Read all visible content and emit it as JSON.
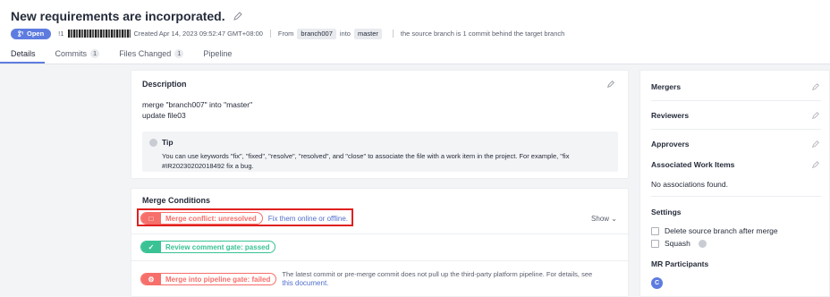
{
  "mr": {
    "title": "New requirements are incorporated.",
    "status": "Open",
    "id": "!1",
    "created": "Created Apr 14, 2023 09:52:47 GMT+08:00",
    "from_label": "From",
    "source_branch": "branch007",
    "into_label": "into",
    "target_branch": "master",
    "behind_note": "the source branch is 1 commit behind the target branch"
  },
  "tabs": [
    {
      "label": "Details",
      "count": ""
    },
    {
      "label": "Commits",
      "count": "1"
    },
    {
      "label": "Files Changed",
      "count": "1"
    },
    {
      "label": "Pipeline",
      "count": ""
    }
  ],
  "description": {
    "title": "Description",
    "line1": "merge \"branch007\" into \"master\"",
    "line2": "update file03",
    "tip_title": "Tip",
    "tip_text": "You can use keywords \"fix\", \"fixed\", \"resolve\", \"resolved\", and \"close\" to associate the file with a work item in the project. For example, \"fix #IR20230202018492 fix a bug."
  },
  "merge_conditions": {
    "title": "Merge Conditions",
    "show_label": "Show",
    "conflict": {
      "label": "Merge conflict: unresolved",
      "link": "Fix them online or offline.",
      "status": "failed"
    },
    "review": {
      "label": "Review comment gate: passed",
      "status": "passed"
    },
    "pipeline": {
      "label": "Merge into pipeline gate: failed",
      "note": "The latest commit or pre-merge commit does not pull up the third-party platform pipeline. For details, see",
      "link": "this document.",
      "status": "failed"
    }
  },
  "sidebar": {
    "mergers": "Mergers",
    "reviewers": "Reviewers",
    "approvers": "Approvers",
    "work_items": "Associated Work Items",
    "no_assoc": "No associations found.",
    "settings": "Settings",
    "delete_branch": "Delete source branch after merge",
    "squash": "Squash",
    "participants": "MR Participants",
    "participant_initial": "C"
  },
  "colors": {
    "accent": "#5e7ce0",
    "fail": "#f66f6a",
    "pass": "#3ac295",
    "highlight": "#e02020"
  }
}
